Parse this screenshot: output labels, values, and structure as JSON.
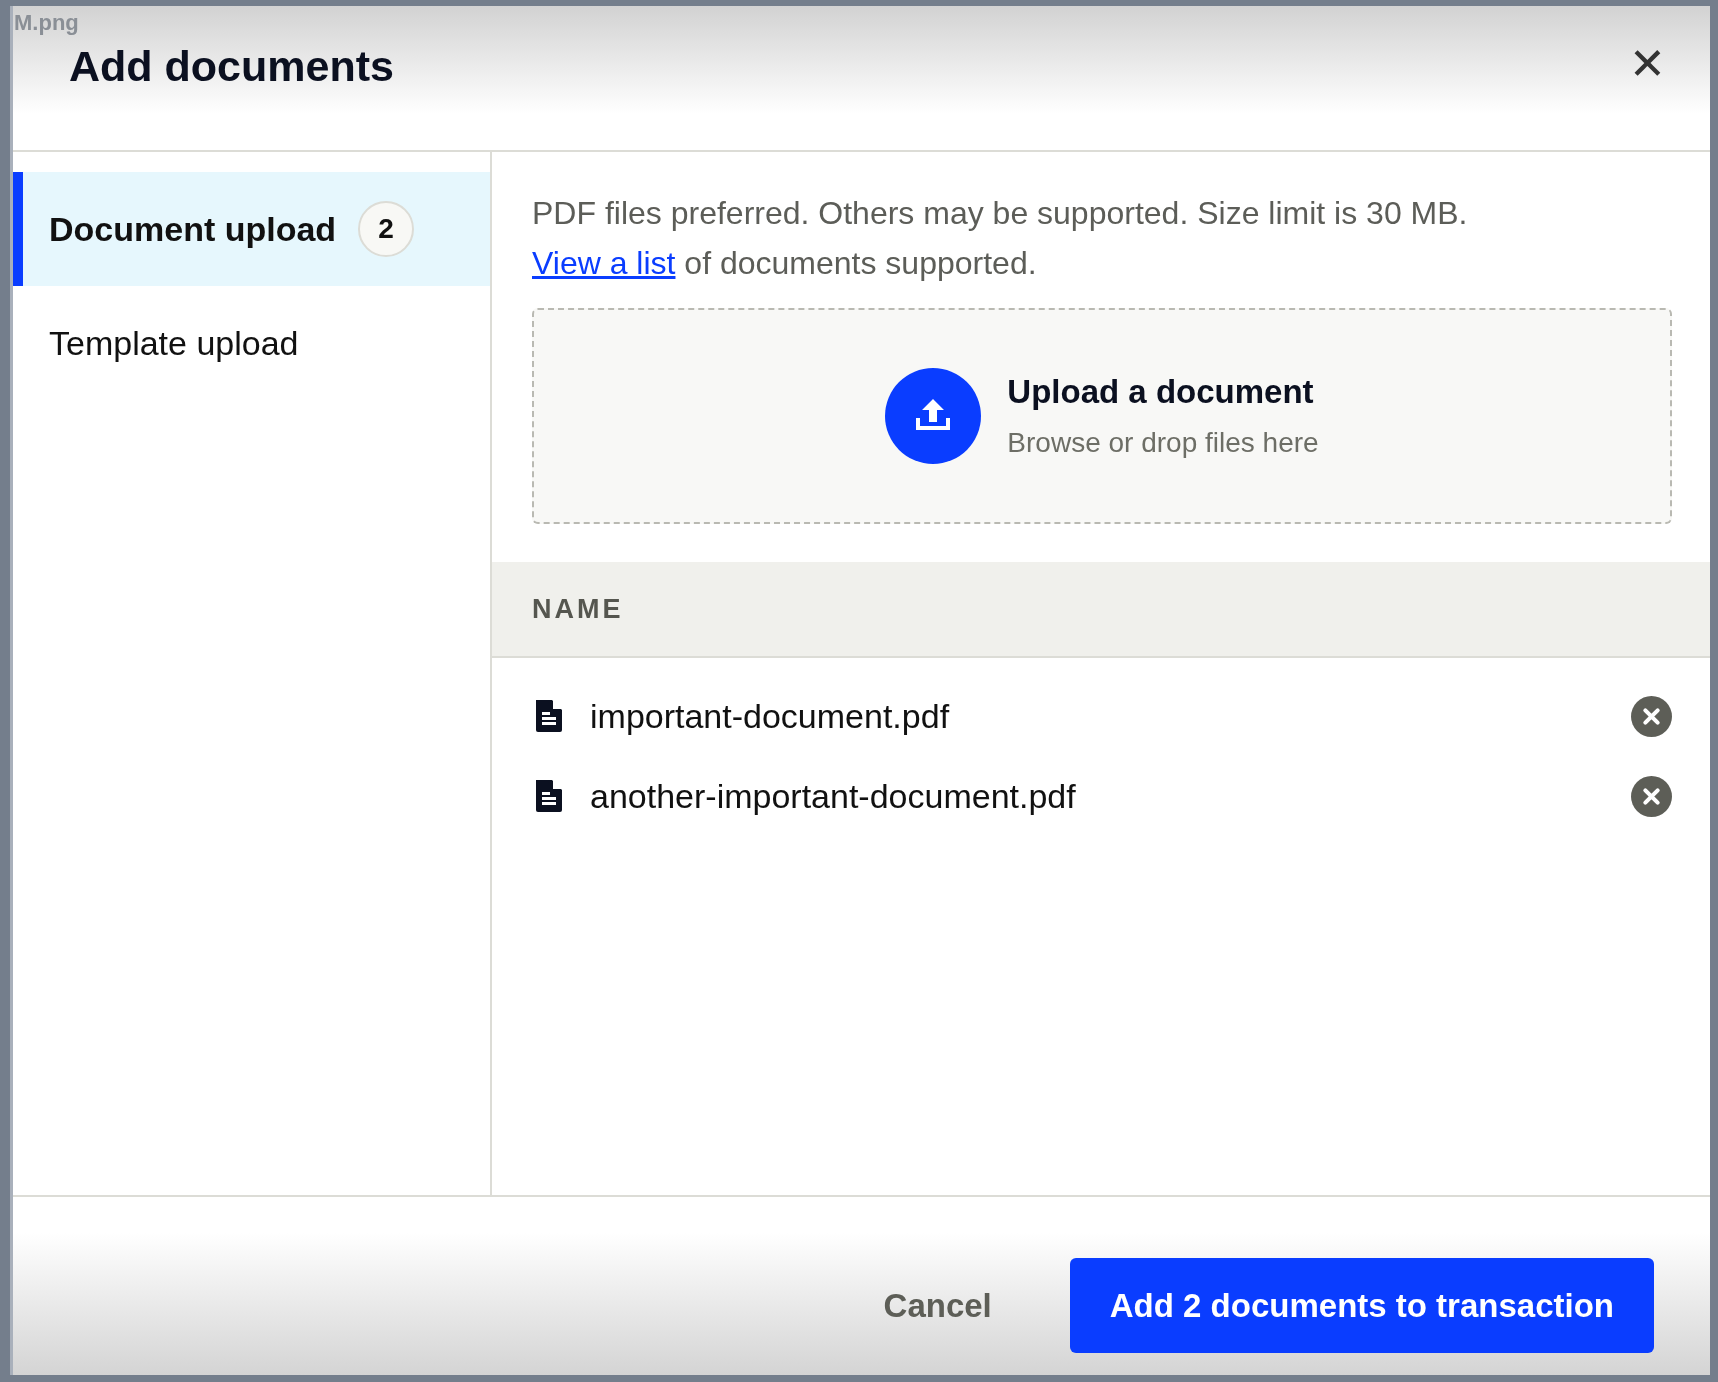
{
  "file_label": "M.png",
  "dialog": {
    "title": "Add documents",
    "close": "✕"
  },
  "sidebar": {
    "items": [
      {
        "label": "Document upload",
        "badge": "2",
        "selected": true
      },
      {
        "label": "Template upload",
        "selected": false
      }
    ]
  },
  "info": {
    "text": "PDF files preferred. Others may be supported. Size limit is 30 MB.",
    "link": "View a list",
    "after_link": "of documents supported."
  },
  "dropzone": {
    "title": "Upload a document",
    "subtitle": "Browse or drop files here"
  },
  "table": {
    "columns": [
      "NAME"
    ],
    "rows": [
      {
        "name": "important-document.pdf"
      },
      {
        "name": "another-important-document.pdf"
      }
    ]
  },
  "footer": {
    "buttons": [
      {
        "label": "Cancel",
        "kind": "secondary"
      },
      {
        "label": "Add 2 documents to transaction",
        "kind": "primary"
      }
    ]
  }
}
